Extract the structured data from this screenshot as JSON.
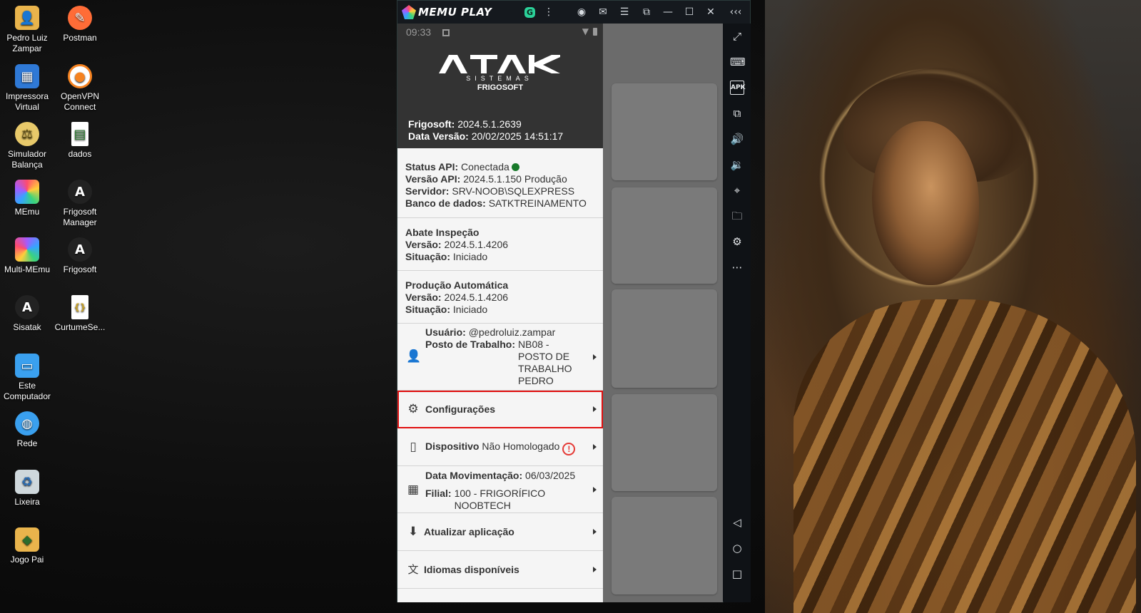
{
  "desktop": {
    "icons": [
      {
        "label_1": "Pedro Luiz",
        "label_2": "Zampar",
        "icon": "folder-user-icon",
        "color": "#e9b44c"
      },
      {
        "label_1": "Postman",
        "label_2": "",
        "icon": "postman-icon",
        "color": "#ff6c37"
      },
      {
        "label_1": "Impressora",
        "label_2": "Virtual",
        "icon": "printer-icon",
        "color": "#2f79d6"
      },
      {
        "label_1": "OpenVPN",
        "label_2": "Connect",
        "icon": "openvpn-icon",
        "color": "#f58220"
      },
      {
        "label_1": "Simulador",
        "label_2": "Balança",
        "icon": "scale-simulator-icon",
        "color": "#e8c96a"
      },
      {
        "label_1": "dados",
        "label_2": "",
        "icon": "spreadsheet-icon",
        "color": "#ffffff"
      },
      {
        "label_1": "MEmu",
        "label_2": "",
        "icon": "memu-icon",
        "color": "#7c5cff"
      },
      {
        "label_1": "Frigosoft",
        "label_2": "Manager",
        "icon": "atak-icon",
        "color": "#222222"
      },
      {
        "label_1": "Multi-MEmu",
        "label_2": "",
        "icon": "multi-memu-icon",
        "color": "#6b4cff"
      },
      {
        "label_1": "Frigosoft",
        "label_2": "",
        "icon": "atak-icon",
        "color": "#222222"
      },
      {
        "label_1": "Sisatak",
        "label_2": "",
        "icon": "atak-icon",
        "color": "#222222"
      },
      {
        "label_1": "CurtumeSe...",
        "label_2": "",
        "icon": "json-file-icon",
        "color": "#ffffff"
      },
      {
        "label_1": "Este",
        "label_2": "Computador",
        "icon": "computer-icon",
        "color": "#3aa0ef"
      },
      {
        "label_1": "Rede",
        "label_2": "",
        "icon": "network-icon",
        "color": "#3aa0ef"
      },
      {
        "label_1": "Lixeira",
        "label_2": "",
        "icon": "recycle-bin-icon",
        "color": "#cfd8dc"
      },
      {
        "label_1": "Jogo Pai",
        "label_2": "",
        "icon": "game-folder-icon",
        "color": "#e9b44c"
      }
    ]
  },
  "memu": {
    "brand": "MEMU PLAY",
    "toolbar_icons": [
      "assistant-icon",
      "more-icon",
      "account-icon",
      "mail-icon",
      "menu-icon",
      "screen-cast-icon",
      "minimize-icon",
      "maximize-icon",
      "close-icon",
      "collapse-sidebar-icon"
    ],
    "side_icons": [
      "fullscreen-icon",
      "keyboard-icon",
      "apk-icon",
      "multi-window-icon",
      "volume-up-icon",
      "volume-down-icon",
      "location-icon",
      "folder-icon",
      "settings-icon",
      "more-icon"
    ],
    "nav_icons": [
      "back-icon",
      "home-icon",
      "recents-icon"
    ]
  },
  "android": {
    "time": "09:33"
  },
  "drawer": {
    "brand_sub": "SISTEMAS",
    "app_name": "FRIGOSOFT",
    "version_label": "Frigosoft:",
    "version_value": "2024.5.1.2639",
    "data_versao_label": "Data Versão:",
    "data_versao_value": "20/02/2025 14:51:17",
    "api": {
      "status_label": "Status API:",
      "status_value": "Conectada",
      "status_color": "#17792a",
      "versao_label": "Versão API:",
      "versao_value": "2024.5.1.150 Produção",
      "servidor_label": "Servidor:",
      "servidor_value": "SRV-NOOB\\SQLEXPRESS",
      "banco_label": "Banco de dados:",
      "banco_value": "SATKTREINAMENTO"
    },
    "modules": [
      {
        "title": "Abate Inspeção",
        "versao_label": "Versão:",
        "versao_value": "2024.5.1.4206",
        "situacao_label": "Situação:",
        "situacao_value": "Iniciado"
      },
      {
        "title": "Produção Automática",
        "versao_label": "Versão:",
        "versao_value": "2024.5.1.4206",
        "situacao_label": "Situação:",
        "situacao_value": "Iniciado"
      }
    ],
    "user": {
      "usuario_label": "Usuário:",
      "usuario_value": "@pedroluiz.zampar",
      "posto_label": "Posto de Trabalho:",
      "posto_lines": [
        "NB08  -",
        "POSTO DE",
        "TRABALHO",
        "PEDRO"
      ]
    },
    "menu": {
      "configuracoes": "Configurações",
      "dispositivo_label": "Dispositivo",
      "dispositivo_value": "Não Homologado",
      "movimentacao_label": "Data Movimentação:",
      "movimentacao_value": "06/03/2025",
      "filial_label": "Filial:",
      "filial_lines": [
        "100 - FRIGORÍFICO",
        "NOOBTECH"
      ],
      "atualizar": "Atualizar aplicação",
      "idiomas": "Idiomas disponíveis"
    }
  }
}
